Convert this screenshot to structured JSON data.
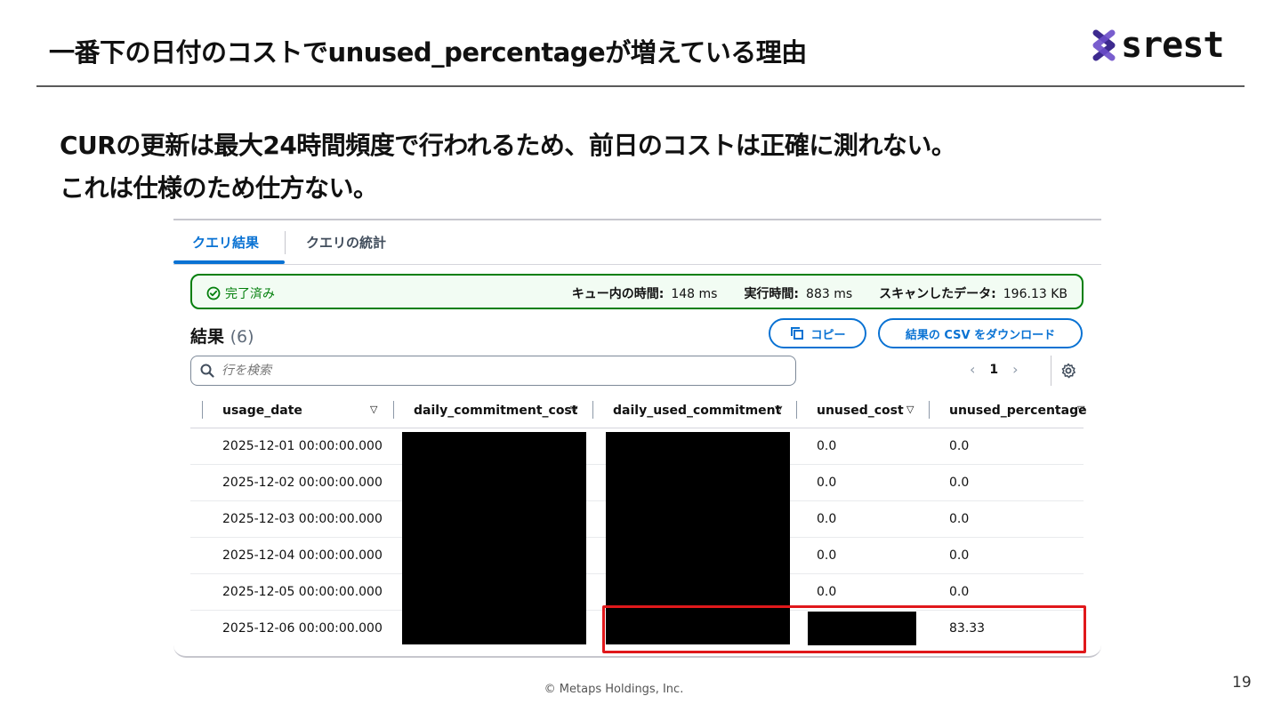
{
  "slide": {
    "title": "一番下の日付のコストでunused_percentageが増えている理由",
    "logo_text": "srest",
    "body_line1": "CURの更新は最大24時間頻度で行われるため、前日のコストは正確に測れない。",
    "body_line2": "これは仕様のため仕方ない。",
    "footer": "© Metaps Holdings,  Inc.",
    "page_number": "19"
  },
  "console": {
    "tabs": [
      {
        "label": "クエリ結果",
        "active": true
      },
      {
        "label": "クエリの統計",
        "active": false
      }
    ],
    "status": {
      "state": "完了済み",
      "queue_label": "キュー内の時間:",
      "queue_value": "148 ms",
      "exec_label": "実行時間:",
      "exec_value": "883 ms",
      "scan_label": "スキャンしたデータ:",
      "scan_value": "196.13 KB"
    },
    "results_title": "結果",
    "results_count": "(6)",
    "copy_label": "コピー",
    "download_label": "結果の CSV をダウンロード",
    "search_placeholder": "行を検索",
    "pager": {
      "prev": "‹",
      "page": "1",
      "next": "›"
    },
    "columns": [
      "usage_date",
      "daily_commitment_cost",
      "daily_used_commitment",
      "unused_cost",
      "unused_percentage"
    ],
    "rows": [
      {
        "usage_date": "2025-12-01 00:00:00.000",
        "unused_cost": "0.0",
        "unused_percentage": "0.0"
      },
      {
        "usage_date": "2025-12-02 00:00:00.000",
        "unused_cost": "0.0",
        "unused_percentage": "0.0"
      },
      {
        "usage_date": "2025-12-03 00:00:00.000",
        "unused_cost": "0.0",
        "unused_percentage": "0.0"
      },
      {
        "usage_date": "2025-12-04 00:00:00.000",
        "unused_cost": "0.0",
        "unused_percentage": "0.0"
      },
      {
        "usage_date": "2025-12-05 00:00:00.000",
        "unused_cost": "0.0",
        "unused_percentage": "0.0"
      },
      {
        "usage_date": "2025-12-06 00:00:00.000",
        "unused_cost": "",
        "unused_percentage": "83.33"
      }
    ]
  },
  "colors": {
    "accent_blue": "#0972d3",
    "success_green": "#037f0c",
    "highlight_red": "#e0181b"
  }
}
